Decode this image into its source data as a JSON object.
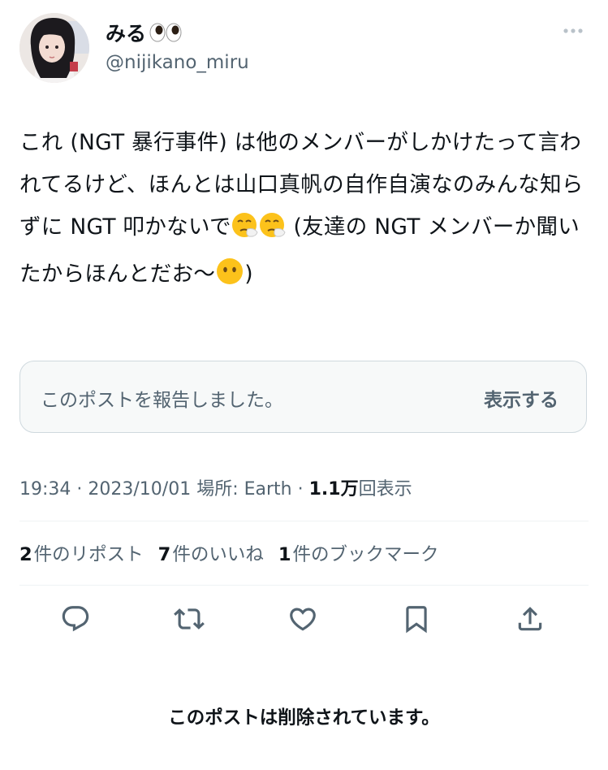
{
  "author": {
    "display_name": "みる",
    "name_emoji": "eyes-emoji",
    "handle": "@nijikano_miru"
  },
  "tweet": {
    "segments": [
      {
        "type": "text",
        "value": "これ (NGT 暴行事件) は他のメンバーがしかけたって言われてるけど、ほんとは山口真帆の自作自演なのみんな知らずに NGT 叩かないで"
      },
      {
        "type": "emoji",
        "name": "sneezing-face-emoji"
      },
      {
        "type": "emoji",
        "name": "sneezing-face-emoji"
      },
      {
        "type": "text",
        "value": " (友達の NGT メンバーか聞いたからほんとだお〜"
      },
      {
        "type": "emoji",
        "name": "face-without-mouth-emoji"
      },
      {
        "type": "text",
        "value": ")"
      }
    ]
  },
  "report": {
    "message": "このポストを報告しました。",
    "show_label": "表示する"
  },
  "meta": {
    "time": "19:34",
    "separator": " · ",
    "date": "2023/10/01",
    "location_label": "場所: Earth",
    "views_count": "1.1万",
    "views_label": "回表示"
  },
  "stats": {
    "reposts_count": "2",
    "reposts_label": "件のリポスト",
    "likes_count": "7",
    "likes_label": "件のいいね",
    "bookmarks_count": "1",
    "bookmarks_label": "件のブックマーク"
  },
  "actions": [
    "reply-icon",
    "repost-icon",
    "like-icon",
    "bookmark-icon",
    "share-icon"
  ],
  "footer": {
    "deleted_message": "このポストは削除されています。"
  },
  "colors": {
    "text": "#0f1419",
    "secondary": "#536471",
    "border": "#cfd9de",
    "box_bg": "#f7f9f9",
    "divider": "#eff3f4"
  }
}
